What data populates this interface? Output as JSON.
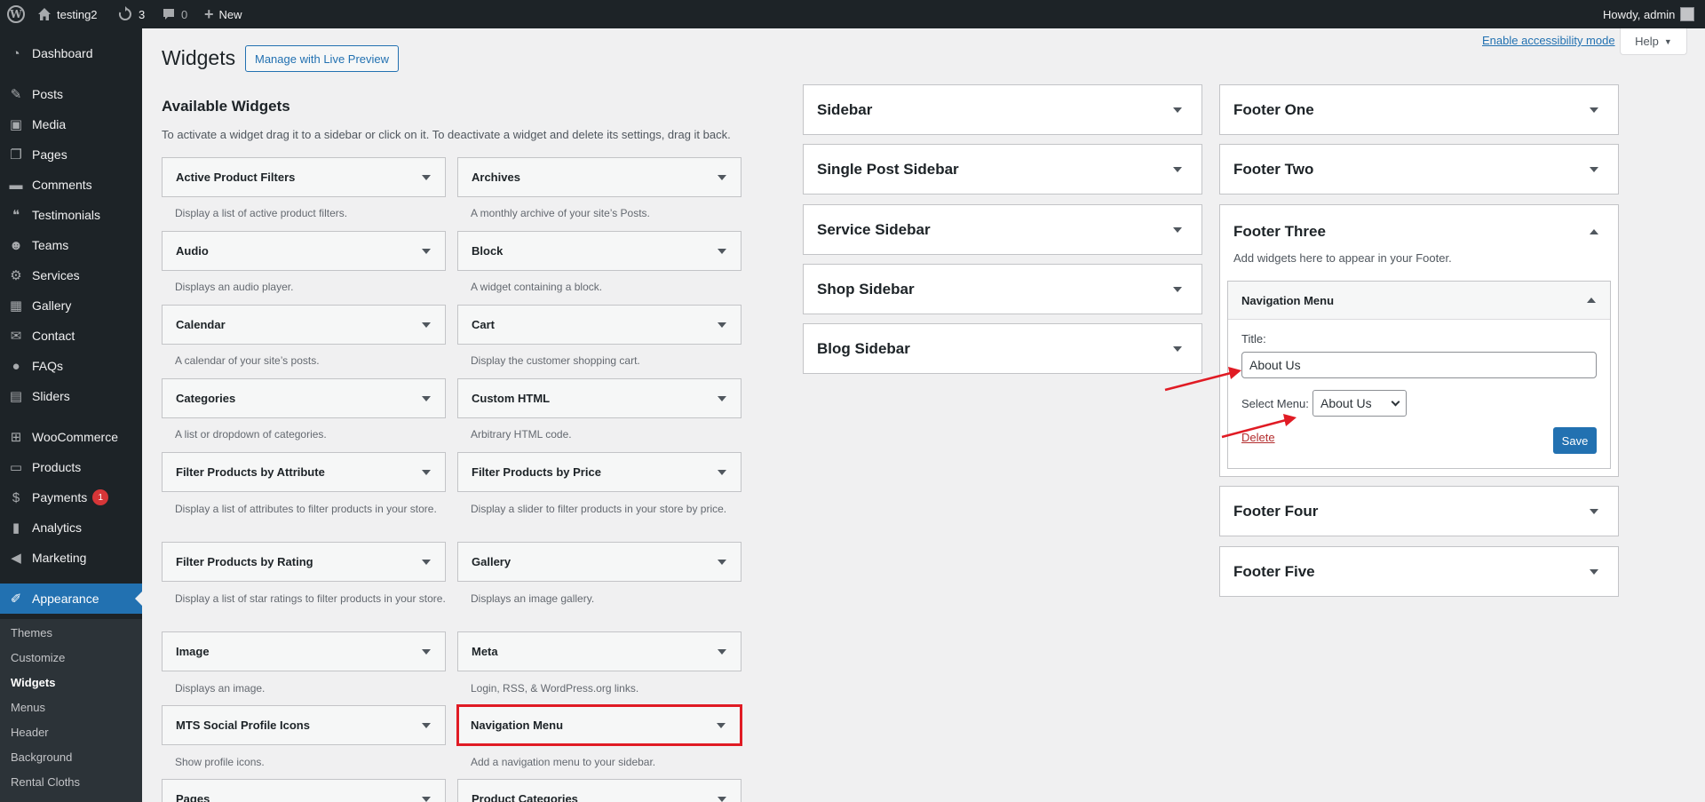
{
  "adminbar": {
    "site_name": "testing2",
    "updates_count": "3",
    "comments_count": "0",
    "new_label": "New",
    "howdy": "Howdy, admin"
  },
  "menu": {
    "dashboard": "Dashboard",
    "posts": "Posts",
    "media": "Media",
    "pages": "Pages",
    "comments": "Comments",
    "testimonials": "Testimonials",
    "teams": "Teams",
    "services": "Services",
    "gallery": "Gallery",
    "contact": "Contact",
    "faqs": "FAQs",
    "sliders": "Sliders",
    "woocommerce": "WooCommerce",
    "products": "Products",
    "payments": "Payments",
    "payments_badge": "1",
    "analytics": "Analytics",
    "marketing": "Marketing",
    "appearance": "Appearance"
  },
  "submenu": {
    "themes": "Themes",
    "customize": "Customize",
    "widgets": "Widgets",
    "menus": "Menus",
    "header": "Header",
    "background": "Background",
    "rental_cloths": "Rental Cloths"
  },
  "page": {
    "title": "Widgets",
    "live_preview": "Manage with Live Preview",
    "accessibility": "Enable accessibility mode",
    "help": "Help"
  },
  "available": {
    "title": "Available Widgets",
    "description": "To activate a widget drag it to a sidebar or click on it. To deactivate a widget and delete its settings, drag it back."
  },
  "widgets": [
    {
      "name": "Active Product Filters",
      "desc": "Display a list of active product filters."
    },
    {
      "name": "Archives",
      "desc": "A monthly archive of your site’s Posts."
    },
    {
      "name": "Audio",
      "desc": "Displays an audio player."
    },
    {
      "name": "Block",
      "desc": "A widget containing a block."
    },
    {
      "name": "Calendar",
      "desc": "A calendar of your site’s posts."
    },
    {
      "name": "Cart",
      "desc": "Display the customer shopping cart."
    },
    {
      "name": "Categories",
      "desc": "A list or dropdown of categories."
    },
    {
      "name": "Custom HTML",
      "desc": "Arbitrary HTML code."
    },
    {
      "name": "Filter Products by Attribute",
      "desc": "Display a list of attributes to filter products in your store."
    },
    {
      "name": "Filter Products by Price",
      "desc": "Display a slider to filter products in your store by price."
    },
    {
      "name": "Filter Products by Rating",
      "desc": "Display a list of star ratings to filter products in your store."
    },
    {
      "name": "Gallery",
      "desc": "Displays an image gallery."
    },
    {
      "name": "Image",
      "desc": "Displays an image."
    },
    {
      "name": "Meta",
      "desc": "Login, RSS, & WordPress.org links."
    },
    {
      "name": "MTS Social Profile Icons",
      "desc": "Show profile icons."
    },
    {
      "name": "Navigation Menu",
      "desc": "Add a navigation menu to your sidebar."
    },
    {
      "name": "Pages",
      "desc": ""
    },
    {
      "name": "Product Categories",
      "desc": ""
    }
  ],
  "sidebars": [
    "Sidebar",
    "Single Post Sidebar",
    "Service Sidebar",
    "Shop Sidebar",
    "Blog Sidebar"
  ],
  "footers": {
    "one": "Footer One",
    "two": "Footer Two",
    "three": "Footer Three",
    "three_desc": "Add widgets here to appear in your Footer.",
    "four": "Footer Four",
    "five": "Footer Five"
  },
  "nav_widget": {
    "title": "Navigation Menu",
    "title_label": "Title:",
    "title_value": "About Us",
    "select_label": "Select Menu:",
    "select_value": "About Us",
    "delete": "Delete",
    "save": "Save"
  },
  "colors": {
    "accent": "#2271b1",
    "admin_bar": "#1d2327",
    "annotation": "#e01b24"
  }
}
